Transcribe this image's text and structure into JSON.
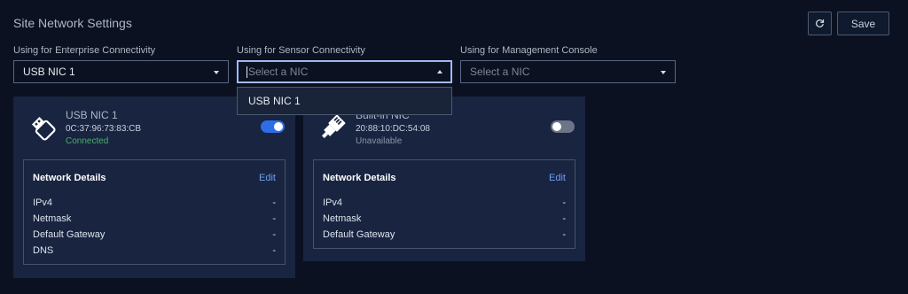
{
  "header": {
    "title": "Site Network Settings",
    "save_label": "Save"
  },
  "selectors": [
    {
      "label": "Using for Enterprise Connectivity",
      "value": "USB NIC 1",
      "placeholder": ""
    },
    {
      "label": "Using for Sensor Connectivity",
      "value": "",
      "placeholder": "Select a NIC"
    },
    {
      "label": "Using for Management Console",
      "value": "",
      "placeholder": "Select a NIC"
    }
  ],
  "dropdown": {
    "options": [
      "USB NIC 1"
    ]
  },
  "nics": [
    {
      "name": "USB NIC 1",
      "mac": "0C:37:96:73:83:CB",
      "status": "Connected",
      "enabled": true,
      "details_title": "Network Details",
      "edit_label": "Edit",
      "rows": [
        {
          "label": "IPv4",
          "value": "-"
        },
        {
          "label": "Netmask",
          "value": "-"
        },
        {
          "label": "Default Gateway",
          "value": "-"
        },
        {
          "label": "DNS",
          "value": "-"
        }
      ]
    },
    {
      "name": "Built-in NIC",
      "mac": "20:88:10:DC:54:08",
      "status": "Unavailable",
      "enabled": false,
      "details_title": "Network Details",
      "edit_label": "Edit",
      "rows": [
        {
          "label": "IPv4",
          "value": "-"
        },
        {
          "label": "Netmask",
          "value": "-"
        },
        {
          "label": "Default Gateway",
          "value": "-"
        }
      ]
    }
  ],
  "colors": {
    "background": "#0b1120",
    "card": "#182440",
    "accent": "#2d6de6",
    "connected": "#4caf6a",
    "link": "#6f9ef0"
  },
  "icons": {
    "refresh": "refresh-icon",
    "usb": "usb-stick-icon",
    "ethernet": "ethernet-plug-icon"
  }
}
